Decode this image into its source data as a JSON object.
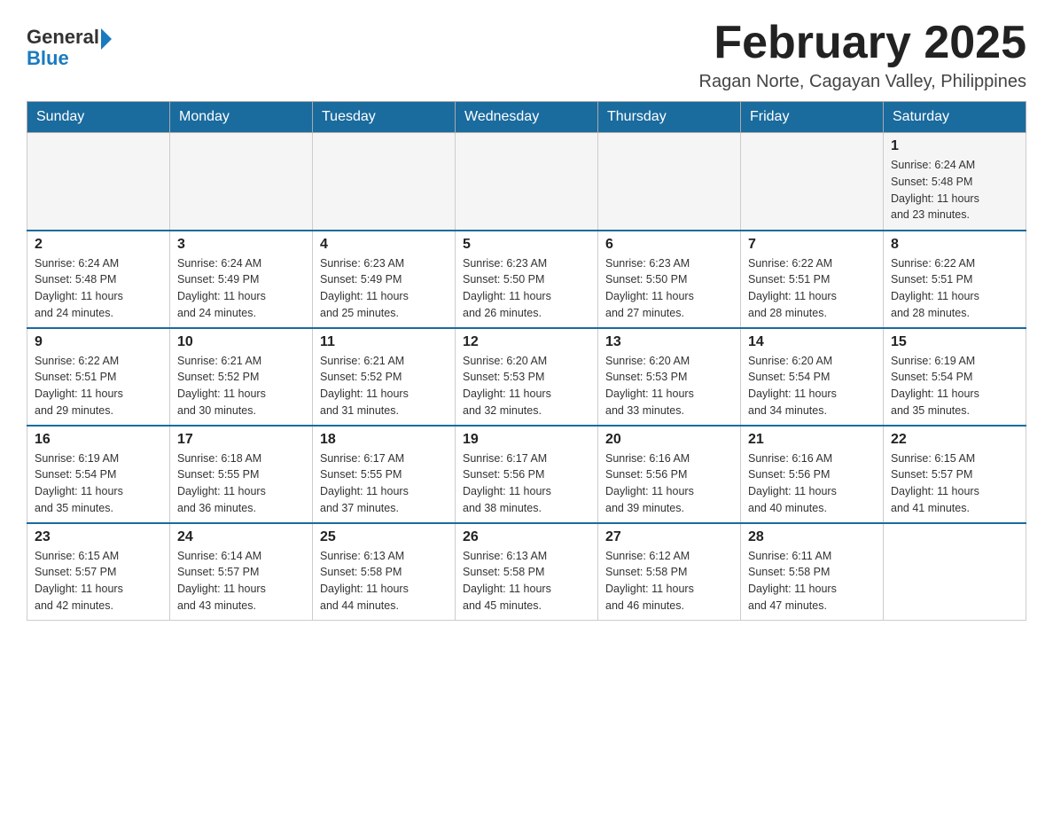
{
  "header": {
    "logo_general": "General",
    "logo_blue": "Blue",
    "month_title": "February 2025",
    "location": "Ragan Norte, Cagayan Valley, Philippines"
  },
  "weekdays": [
    "Sunday",
    "Monday",
    "Tuesday",
    "Wednesday",
    "Thursday",
    "Friday",
    "Saturday"
  ],
  "weeks": [
    [
      {
        "day": "",
        "info": ""
      },
      {
        "day": "",
        "info": ""
      },
      {
        "day": "",
        "info": ""
      },
      {
        "day": "",
        "info": ""
      },
      {
        "day": "",
        "info": ""
      },
      {
        "day": "",
        "info": ""
      },
      {
        "day": "1",
        "info": "Sunrise: 6:24 AM\nSunset: 5:48 PM\nDaylight: 11 hours\nand 23 minutes."
      }
    ],
    [
      {
        "day": "2",
        "info": "Sunrise: 6:24 AM\nSunset: 5:48 PM\nDaylight: 11 hours\nand 24 minutes."
      },
      {
        "day": "3",
        "info": "Sunrise: 6:24 AM\nSunset: 5:49 PM\nDaylight: 11 hours\nand 24 minutes."
      },
      {
        "day": "4",
        "info": "Sunrise: 6:23 AM\nSunset: 5:49 PM\nDaylight: 11 hours\nand 25 minutes."
      },
      {
        "day": "5",
        "info": "Sunrise: 6:23 AM\nSunset: 5:50 PM\nDaylight: 11 hours\nand 26 minutes."
      },
      {
        "day": "6",
        "info": "Sunrise: 6:23 AM\nSunset: 5:50 PM\nDaylight: 11 hours\nand 27 minutes."
      },
      {
        "day": "7",
        "info": "Sunrise: 6:22 AM\nSunset: 5:51 PM\nDaylight: 11 hours\nand 28 minutes."
      },
      {
        "day": "8",
        "info": "Sunrise: 6:22 AM\nSunset: 5:51 PM\nDaylight: 11 hours\nand 28 minutes."
      }
    ],
    [
      {
        "day": "9",
        "info": "Sunrise: 6:22 AM\nSunset: 5:51 PM\nDaylight: 11 hours\nand 29 minutes."
      },
      {
        "day": "10",
        "info": "Sunrise: 6:21 AM\nSunset: 5:52 PM\nDaylight: 11 hours\nand 30 minutes."
      },
      {
        "day": "11",
        "info": "Sunrise: 6:21 AM\nSunset: 5:52 PM\nDaylight: 11 hours\nand 31 minutes."
      },
      {
        "day": "12",
        "info": "Sunrise: 6:20 AM\nSunset: 5:53 PM\nDaylight: 11 hours\nand 32 minutes."
      },
      {
        "day": "13",
        "info": "Sunrise: 6:20 AM\nSunset: 5:53 PM\nDaylight: 11 hours\nand 33 minutes."
      },
      {
        "day": "14",
        "info": "Sunrise: 6:20 AM\nSunset: 5:54 PM\nDaylight: 11 hours\nand 34 minutes."
      },
      {
        "day": "15",
        "info": "Sunrise: 6:19 AM\nSunset: 5:54 PM\nDaylight: 11 hours\nand 35 minutes."
      }
    ],
    [
      {
        "day": "16",
        "info": "Sunrise: 6:19 AM\nSunset: 5:54 PM\nDaylight: 11 hours\nand 35 minutes."
      },
      {
        "day": "17",
        "info": "Sunrise: 6:18 AM\nSunset: 5:55 PM\nDaylight: 11 hours\nand 36 minutes."
      },
      {
        "day": "18",
        "info": "Sunrise: 6:17 AM\nSunset: 5:55 PM\nDaylight: 11 hours\nand 37 minutes."
      },
      {
        "day": "19",
        "info": "Sunrise: 6:17 AM\nSunset: 5:56 PM\nDaylight: 11 hours\nand 38 minutes."
      },
      {
        "day": "20",
        "info": "Sunrise: 6:16 AM\nSunset: 5:56 PM\nDaylight: 11 hours\nand 39 minutes."
      },
      {
        "day": "21",
        "info": "Sunrise: 6:16 AM\nSunset: 5:56 PM\nDaylight: 11 hours\nand 40 minutes."
      },
      {
        "day": "22",
        "info": "Sunrise: 6:15 AM\nSunset: 5:57 PM\nDaylight: 11 hours\nand 41 minutes."
      }
    ],
    [
      {
        "day": "23",
        "info": "Sunrise: 6:15 AM\nSunset: 5:57 PM\nDaylight: 11 hours\nand 42 minutes."
      },
      {
        "day": "24",
        "info": "Sunrise: 6:14 AM\nSunset: 5:57 PM\nDaylight: 11 hours\nand 43 minutes."
      },
      {
        "day": "25",
        "info": "Sunrise: 6:13 AM\nSunset: 5:58 PM\nDaylight: 11 hours\nand 44 minutes."
      },
      {
        "day": "26",
        "info": "Sunrise: 6:13 AM\nSunset: 5:58 PM\nDaylight: 11 hours\nand 45 minutes."
      },
      {
        "day": "27",
        "info": "Sunrise: 6:12 AM\nSunset: 5:58 PM\nDaylight: 11 hours\nand 46 minutes."
      },
      {
        "day": "28",
        "info": "Sunrise: 6:11 AM\nSunset: 5:58 PM\nDaylight: 11 hours\nand 47 minutes."
      },
      {
        "day": "",
        "info": ""
      }
    ]
  ]
}
